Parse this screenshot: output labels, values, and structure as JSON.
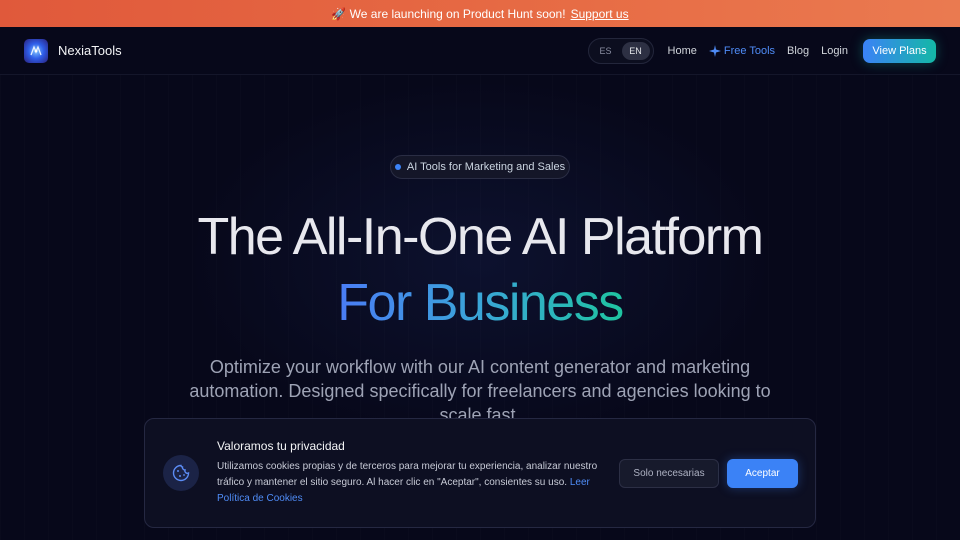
{
  "announcement": {
    "icon": "rocket-icon",
    "text": "🚀 We are launching on Product Hunt soon!",
    "link": "Support us"
  },
  "nav": {
    "brand": "NexiaTools",
    "lang": {
      "es": "ES",
      "en": "EN",
      "selected": "EN"
    },
    "links": {
      "home": "Home",
      "free_tools": "Free Tools",
      "blog": "Blog",
      "login": "Login"
    },
    "cta": "View Plans"
  },
  "hero": {
    "badge": "AI Tools for Marketing and Sales",
    "title_line1": "The All-In-One AI Platform",
    "title_line2": "For Business",
    "subtitle": "Optimize your workflow with our AI content generator and marketing automation. Designed specifically for freelancers and agencies looking to scale fast."
  },
  "cookie_banner": {
    "title": "Valoramos tu privacidad",
    "text": "Utilizamos cookies propias y de terceros para mejorar tu experiencia, analizar nuestro tráfico y mantener el sitio seguro. Al hacer clic en \"Aceptar\", consientes su uso.",
    "policy_link": "Leer Política de Cookies",
    "necessary_button": "Solo necesarias",
    "accept_button": "Aceptar"
  },
  "colors": {
    "announcement_bg": "#e76c45",
    "accent_blue": "#3b82f6",
    "accent_teal": "#14b8a6",
    "page_bg": "#07081a"
  }
}
